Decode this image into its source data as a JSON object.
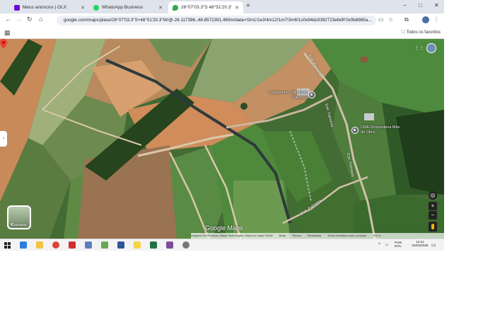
{
  "browser": {
    "tabs": [
      {
        "title": "Meus anúncios | OLX",
        "favicon_color": "#6e0ad6",
        "active": false
      },
      {
        "title": "WhatsApp Business",
        "favicon_color": "#25d366",
        "active": false
      },
      {
        "title": "26°07'03.3\"S 48°51'20.3\"W - G...",
        "favicon_color": "#34a853",
        "active": true
      }
    ],
    "new_tab_symbol": "+",
    "window_controls": [
      "−",
      "□",
      "✕"
    ],
    "url": "google.com/maps/place/26°07'03.3\"S+48°51'20.3\"W/@-26.117396,-48.8572391,460m/data=!3m1!1e3!4m12!1m7!3m6!1s0x94dc0392723efe9f:0x0b8985a...",
    "bookmarks_all": "Todos os favoritos"
  },
  "map": {
    "labels": {
      "poi1": "Loteamento Villa Dona Francisca",
      "poi2": "CMEI Empreiteira Mão de Obra",
      "road1": "Estr. Palmeira",
      "road2": "Estr. Palmeira",
      "road3": "Estr. Palmeira",
      "road4": "Estr. Palmeira"
    },
    "layers_label": "Camadas",
    "google_logo": "Google Maps",
    "attribution": [
      "Imagens ©2026 Airbus, Maxar Technologies, Dados do mapa ©2026",
      "Brasil",
      "Termos",
      "Privacidade",
      "Enviar feedback sobre o produto",
      "200 m"
    ],
    "colors": {
      "pin": "#ea4335",
      "poi": "#5f6368"
    }
  },
  "taskbar": {
    "apps": [
      {
        "name": "edge",
        "color": "#2b7de1"
      },
      {
        "name": "explorer",
        "color": "#f3c343"
      },
      {
        "name": "chrome",
        "color": "#db4437"
      },
      {
        "name": "pdf",
        "color": "#d32f2f"
      },
      {
        "name": "app5",
        "color": "#5a7fbf"
      },
      {
        "name": "app6",
        "color": "#6aa84f"
      },
      {
        "name": "word",
        "color": "#2b579a"
      },
      {
        "name": "sticky",
        "color": "#f7d34a"
      },
      {
        "name": "excel",
        "color": "#217346"
      },
      {
        "name": "app10",
        "color": "#7a4c9c"
      },
      {
        "name": "app11",
        "color": "#777777"
      }
    ],
    "lang_top": "POR",
    "lang_bottom": "INTL",
    "time": "14:41",
    "date": "03/03/2026"
  }
}
